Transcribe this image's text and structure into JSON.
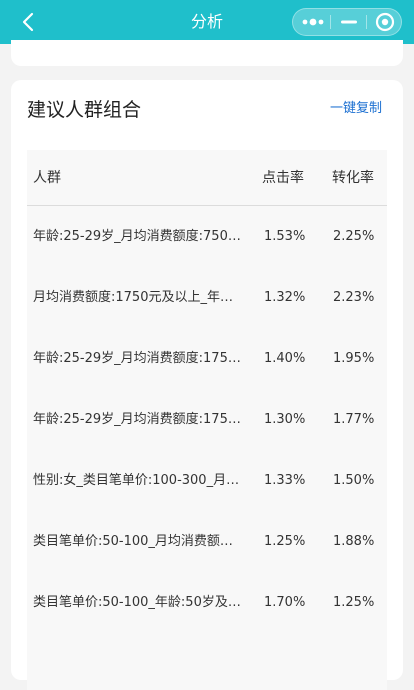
{
  "header": {
    "title": "分析",
    "bg_color": "#1fbfcb"
  },
  "icons": {
    "back": "chevron-left-icon",
    "more": "more-dots-icon",
    "minimize": "minimize-icon",
    "close": "target-circle-icon"
  },
  "section": {
    "title": "建议人群组合",
    "copy_label": "一键复制",
    "link_color": "#1b6fd1"
  },
  "table": {
    "headers": {
      "crowd": "人群",
      "ctr": "点击率",
      "cvr": "转化率"
    },
    "rows": [
      {
        "crowd": "年龄:25-29岁_月均消费额度:750…",
        "ctr": "1.53%",
        "cvr": "2.25%"
      },
      {
        "crowd": "月均消费额度:1750元及以上_年…",
        "ctr": "1.32%",
        "cvr": "2.23%"
      },
      {
        "crowd": "年龄:25-29岁_月均消费额度:175…",
        "ctr": "1.40%",
        "cvr": "1.95%"
      },
      {
        "crowd": "年龄:25-29岁_月均消费额度:175…",
        "ctr": "1.30%",
        "cvr": "1.77%"
      },
      {
        "crowd": "性别:女_类目笔单价:100-300_月…",
        "ctr": "1.33%",
        "cvr": "1.50%"
      },
      {
        "crowd": "类目笔单价:50-100_月均消费额…",
        "ctr": "1.25%",
        "cvr": "1.88%"
      },
      {
        "crowd": "类目笔单价:50-100_年龄:50岁及…",
        "ctr": "1.70%",
        "cvr": "1.25%"
      }
    ]
  }
}
